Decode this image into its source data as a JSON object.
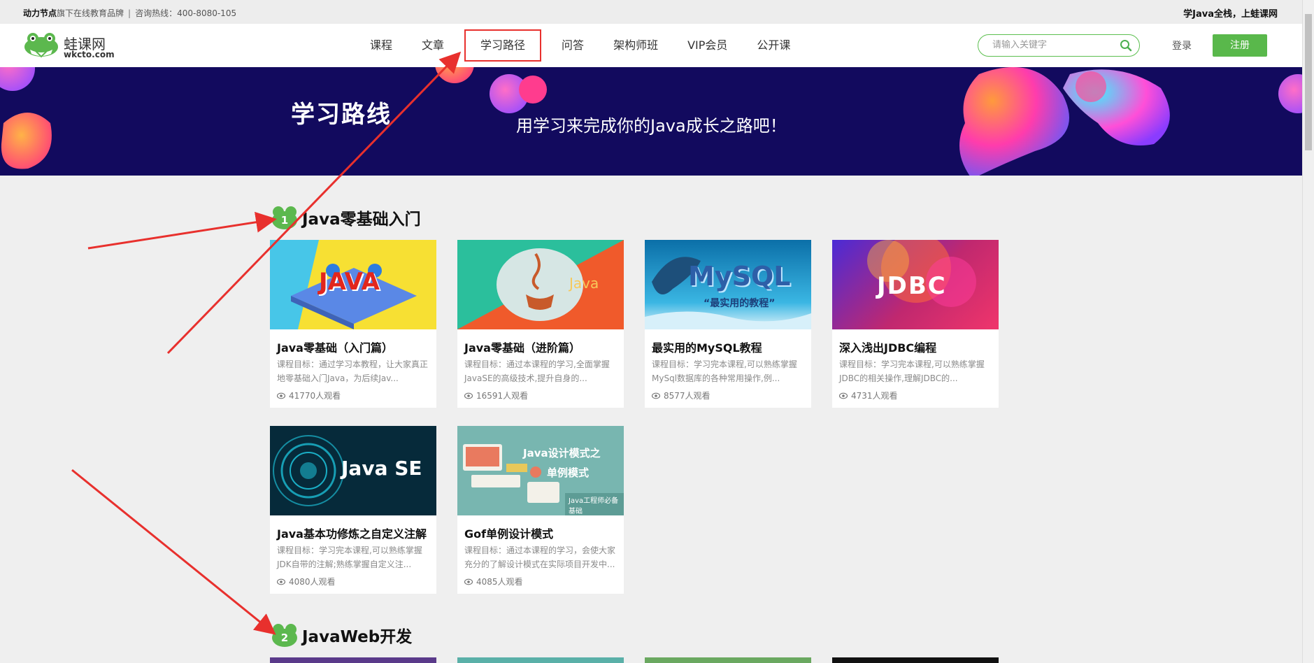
{
  "topbar": {
    "brand": "动力节点",
    "brand_suffix": "旗下在线教育品牌",
    "separator": "|",
    "hotline": "咨询热线：400-8080-105",
    "slogan": "学Java全栈，上蛙课网"
  },
  "logo": {
    "name": "蛙课网",
    "domain": "wkcto.com"
  },
  "nav": [
    {
      "label": "课程"
    },
    {
      "label": "文章"
    },
    {
      "label": "学习路径"
    },
    {
      "label": "问答"
    },
    {
      "label": "架构师班"
    },
    {
      "label": "VIP会员"
    },
    {
      "label": "公开课"
    }
  ],
  "search": {
    "placeholder": "请输入关键字",
    "value": ""
  },
  "auth": {
    "login": "登录",
    "register": "注册"
  },
  "banner": {
    "title": "学习路线",
    "subtitle": "用学习来完成你的Java成长之路吧！"
  },
  "sections": [
    {
      "number": "1",
      "title": "Java零基础入门",
      "cards": [
        {
          "title": "Java零基础（入门篇）",
          "desc": "课程目标：通过学习本教程，让大家真正地零基础入门Java，为后续Jav...",
          "views": "41770人观看",
          "thumb_text": "JAVA"
        },
        {
          "title": "Java零基础（进阶篇）",
          "desc": "课程目标：通过本课程的学习,全面掌握JavaSE的高级技术,提升自身的...",
          "views": "16591人观看",
          "thumb_text": "Java"
        },
        {
          "title": "最实用的MySQL教程",
          "desc": "课程目标：学习完本课程,可以熟练掌握MySql数据库的各种常用操作,例...",
          "views": "8577人观看",
          "thumb_text": "MySQL",
          "thumb_sub": "“最实用的教程”"
        },
        {
          "title": "深入浅出JDBC编程",
          "desc": "课程目标：学习完本课程,可以熟练掌握JDBC的相关操作,理解JDBC的...",
          "views": "4731人观看",
          "thumb_text": "JDBC"
        },
        {
          "title": "Java基本功修炼之自定义注解",
          "desc": "课程目标：学习完本课程,可以熟练掌握JDK自带的注解;熟练掌握自定义注...",
          "views": "4080人观看",
          "thumb_text": "Java SE"
        },
        {
          "title": "Gof单例设计模式",
          "desc": "课程目标：通过本课程的学习，会使大家充分的了解设计模式在实际项目开发中...",
          "views": "4085人观看",
          "thumb_text": "Java设计模式之",
          "thumb_text2": "单例模式",
          "thumb_badge": "Java工程师必备基础"
        }
      ]
    },
    {
      "number": "2",
      "title": "JavaWeb开发"
    }
  ],
  "colors": {
    "accent": "#59b84b",
    "highlight": "#e8302d",
    "banner_bg": "#120a5e"
  }
}
